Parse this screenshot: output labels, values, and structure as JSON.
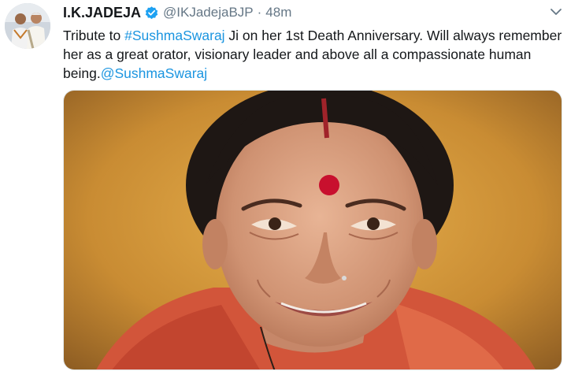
{
  "tweet": {
    "author_name": "I.K.JADEJA",
    "author_handle": "@IKJadejaBJP",
    "separator": "·",
    "time": "48m",
    "text_prefix": "Tribute to ",
    "hashtag": "#SushmaSwaraj",
    "text_body": " Ji on her 1st  Death Anniversary. Will always remember her as a great orator, visionary leader and above all a compassionate human being.",
    "mention": "@SushmaSwaraj"
  },
  "icons": {
    "verified": "verified-badge-icon",
    "menu": "chevron-down-icon"
  },
  "colors": {
    "link": "#1b95e0",
    "verified": "#1da1f2",
    "secondary_text": "#657786"
  }
}
